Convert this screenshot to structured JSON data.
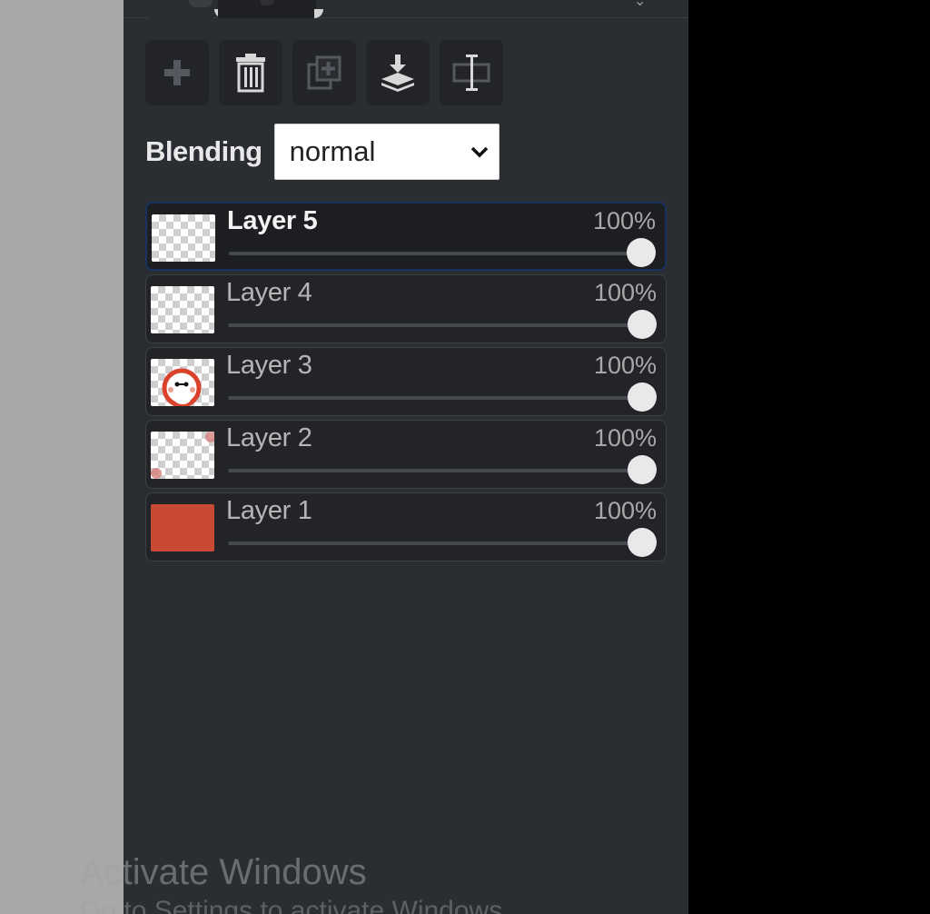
{
  "toolbar": {
    "buttons": [
      {
        "icon": "add-layer-icon"
      },
      {
        "icon": "trash-icon"
      },
      {
        "icon": "duplicate-layer-icon"
      },
      {
        "icon": "merge-down-icon"
      },
      {
        "icon": "resize-layer-icon"
      }
    ]
  },
  "blending": {
    "label": "Blending",
    "value": "normal"
  },
  "layers": [
    {
      "name": "Layer 5",
      "opacity": "100%",
      "selected": true,
      "thumbnail": "transparent"
    },
    {
      "name": "Layer 4",
      "opacity": "100%",
      "selected": false,
      "thumbnail": "transparent"
    },
    {
      "name": "Layer 3",
      "opacity": "100%",
      "selected": false,
      "thumbnail": "face-drawing"
    },
    {
      "name": "Layer 2",
      "opacity": "100%",
      "selected": false,
      "thumbnail": "corner-marks"
    },
    {
      "name": "Layer 1",
      "opacity": "100%",
      "selected": false,
      "thumbnail": "solid",
      "fill_color": "#c94a34"
    }
  ],
  "watermark": {
    "line1": "Activate Windows",
    "line2": "Go to Settings to activate Windows."
  },
  "colors": {
    "panel": "#2a2d31",
    "selected_border": "#19315e",
    "layer1_fill": "#c94a34"
  }
}
